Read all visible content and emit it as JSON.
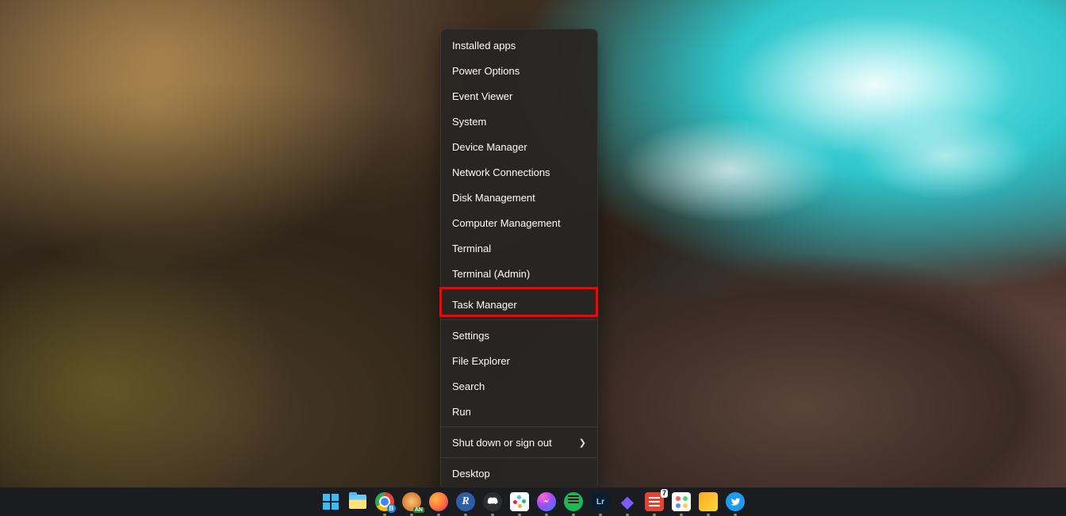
{
  "menu": {
    "items": [
      "Installed apps",
      "Power Options",
      "Event Viewer",
      "System",
      "Device Manager",
      "Network Connections",
      "Disk Management",
      "Computer Management",
      "Terminal",
      "Terminal (Admin)",
      "Task Manager",
      "Settings",
      "File Explorer",
      "Search",
      "Run",
      "Shut down or sign out",
      "Desktop"
    ]
  },
  "highlighted_item": "Task Manager",
  "taskbar": {
    "start": "Start",
    "explorer": "File Explorer",
    "chrome": "Google Chrome",
    "chrome_badge": "B",
    "ganache": "Ganache",
    "ganache_badge": "AN",
    "firefox": "Firefox",
    "rstudio": "R",
    "discord": "Discord",
    "slack": "Slack",
    "messenger": "Messenger",
    "spotify": "Spotify",
    "lightroom": "Lr",
    "obsidian": "Obsidian",
    "todoist": "Todoist",
    "todoist_badge": "7",
    "figma": "App",
    "pieces": "Pieces",
    "twitter": "Twitter"
  }
}
